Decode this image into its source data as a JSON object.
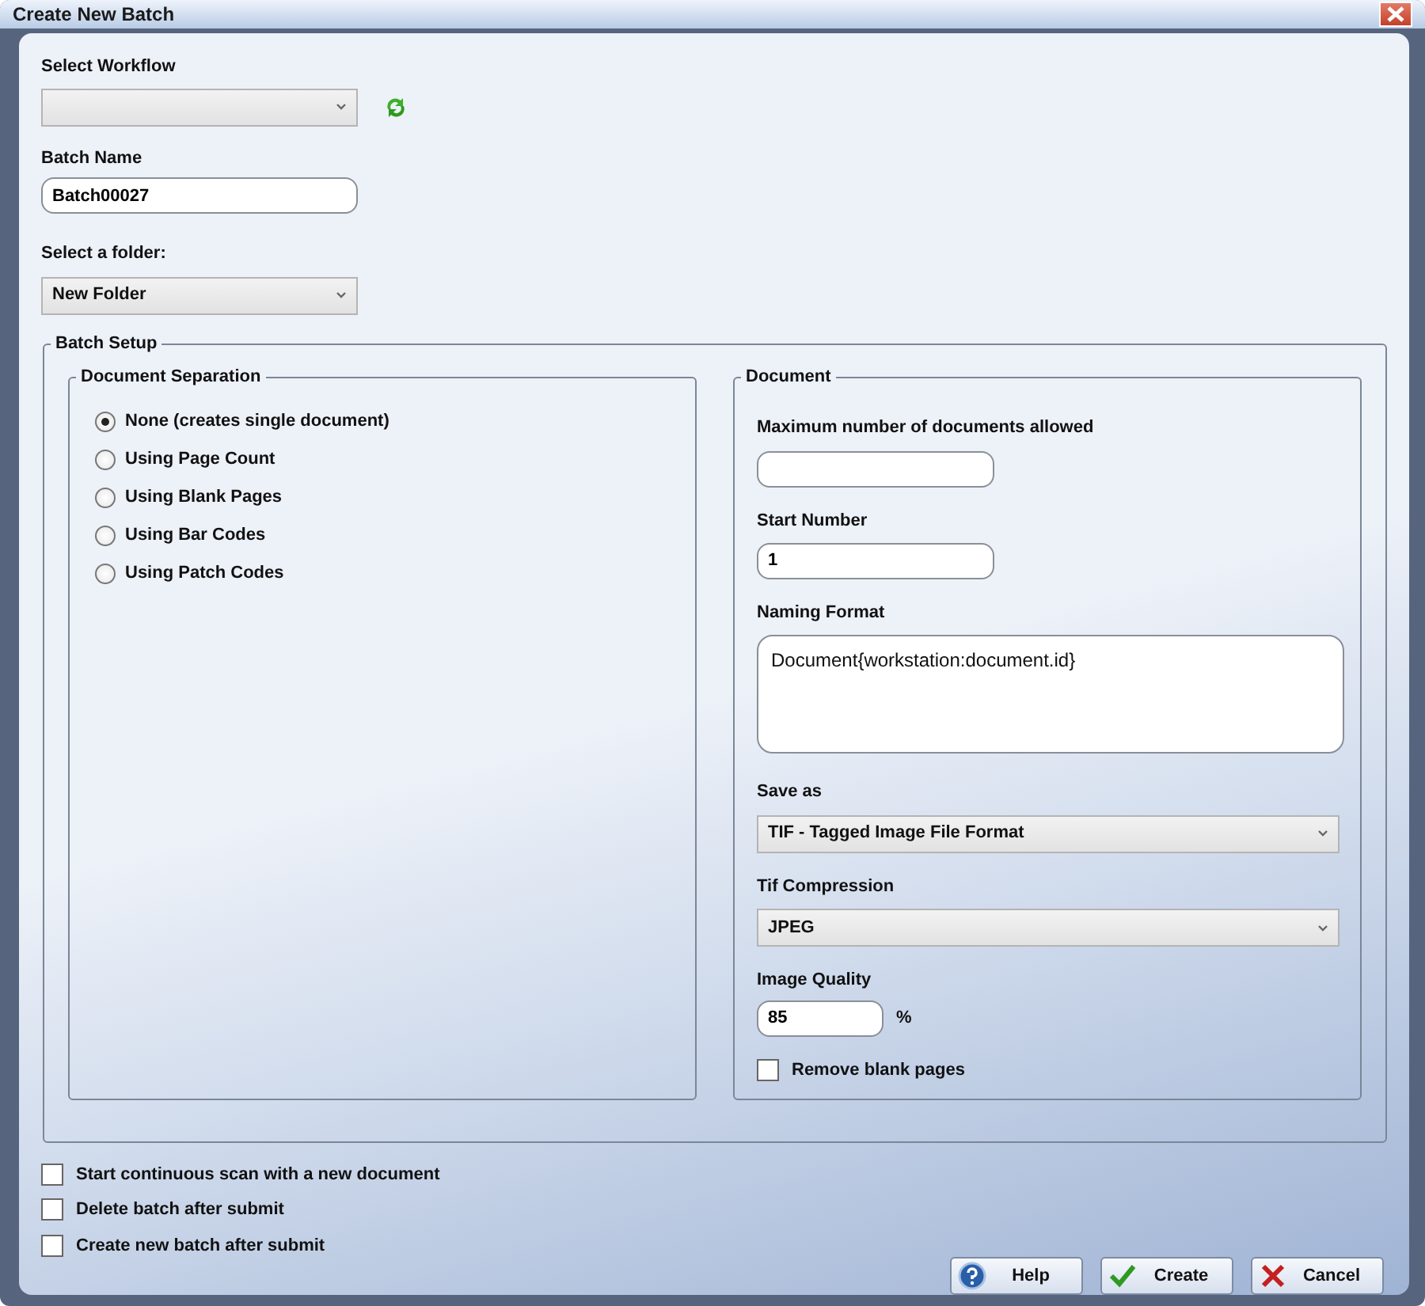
{
  "window": {
    "title": "Create New Batch"
  },
  "workflow": {
    "label": "Select Workflow"
  },
  "batch_name": {
    "label": "Batch Name",
    "value": "Batch00027"
  },
  "folder": {
    "label": "Select a folder:",
    "value": "New Folder"
  },
  "batch_setup": {
    "title": "Batch Setup",
    "separation": {
      "title": "Document Separation",
      "options": [
        {
          "label": "None (creates single document)",
          "selected": true
        },
        {
          "label": "Using Page Count",
          "selected": false
        },
        {
          "label": "Using Blank Pages",
          "selected": false
        },
        {
          "label": "Using Bar Codes",
          "selected": false
        },
        {
          "label": "Using Patch Codes",
          "selected": false
        }
      ]
    },
    "document": {
      "title": "Document",
      "max_documents": {
        "label": "Maximum number of documents allowed"
      },
      "start_number": {
        "label": "Start Number",
        "value": "1"
      },
      "naming_format": {
        "label": "Naming Format",
        "value": "Document{workstation:document.id}"
      },
      "save_as": {
        "label": "Save as",
        "value": "TIF - Tagged Image File Format"
      },
      "tif_compression": {
        "label": "Tif Compression",
        "value": "JPEG"
      },
      "image_quality": {
        "label": "Image Quality",
        "value": "85",
        "unit": "%"
      },
      "remove_blank_pages": {
        "label": "Remove blank pages",
        "checked": false
      }
    }
  },
  "options": [
    {
      "label": "Start continuous scan with a new document",
      "checked": false
    },
    {
      "label": "Delete batch after submit",
      "checked": false
    },
    {
      "label": "Create new batch after submit",
      "checked": false
    }
  ],
  "buttons": [
    {
      "label": "Help",
      "kind": "help"
    },
    {
      "label": "Create",
      "kind": "create"
    },
    {
      "label": "Cancel",
      "kind": "cancel"
    }
  ]
}
